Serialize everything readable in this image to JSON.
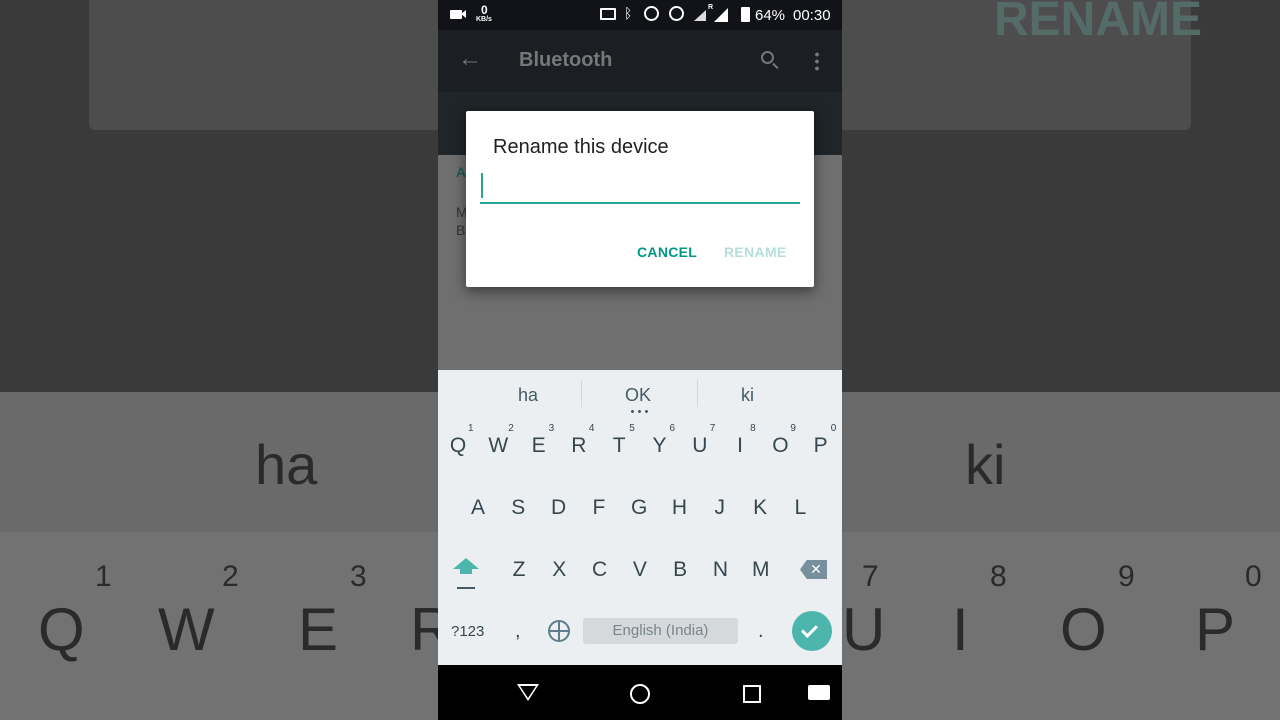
{
  "background": {
    "rename_ghost": "RENAME",
    "suggestions": [
      "ha",
      "ki"
    ],
    "keys": [
      "Q",
      "W",
      "E",
      "R",
      "U",
      "I",
      "O",
      "P"
    ],
    "digits": [
      "1",
      "2",
      "3",
      "7",
      "8",
      "9",
      "0"
    ]
  },
  "status_bar": {
    "net_speed": "0",
    "net_unit": "KB/s",
    "roaming": "R",
    "battery": "64%",
    "time": "00:30",
    "icons": [
      "video-icon",
      "cast-icon",
      "bluetooth-icon",
      "do-not-disturb-icon",
      "alarm-icon",
      "signal-icon",
      "signal-icon",
      "battery-icon"
    ]
  },
  "toolbar": {
    "title": "Bluetooth",
    "icons": [
      "back-arrow-icon",
      "search-icon",
      "more-vert-icon"
    ]
  },
  "behind": {
    "section_initial": "A",
    "line1_initial": "M",
    "line2_initial": "B"
  },
  "dialog": {
    "title": "Rename this device",
    "input_value": "",
    "cancel": "CANCEL",
    "rename": "RENAME"
  },
  "keyboard": {
    "suggestions": [
      "ha",
      "OK",
      "ki"
    ],
    "row1": [
      "Q",
      "W",
      "E",
      "R",
      "T",
      "Y",
      "U",
      "I",
      "O",
      "P"
    ],
    "row1_digits": [
      "1",
      "2",
      "3",
      "4",
      "5",
      "6",
      "7",
      "8",
      "9",
      "0"
    ],
    "row2": [
      "A",
      "S",
      "D",
      "F",
      "G",
      "H",
      "J",
      "K",
      "L"
    ],
    "row3": [
      "Z",
      "X",
      "C",
      "V",
      "B",
      "N",
      "M"
    ],
    "symbols": "?123",
    "comma": ",",
    "space": "English (India)",
    "period": ".",
    "accent": "#4db6ac"
  },
  "colors": {
    "teal": "#009688",
    "disabled_teal": "#b2dfdb"
  }
}
